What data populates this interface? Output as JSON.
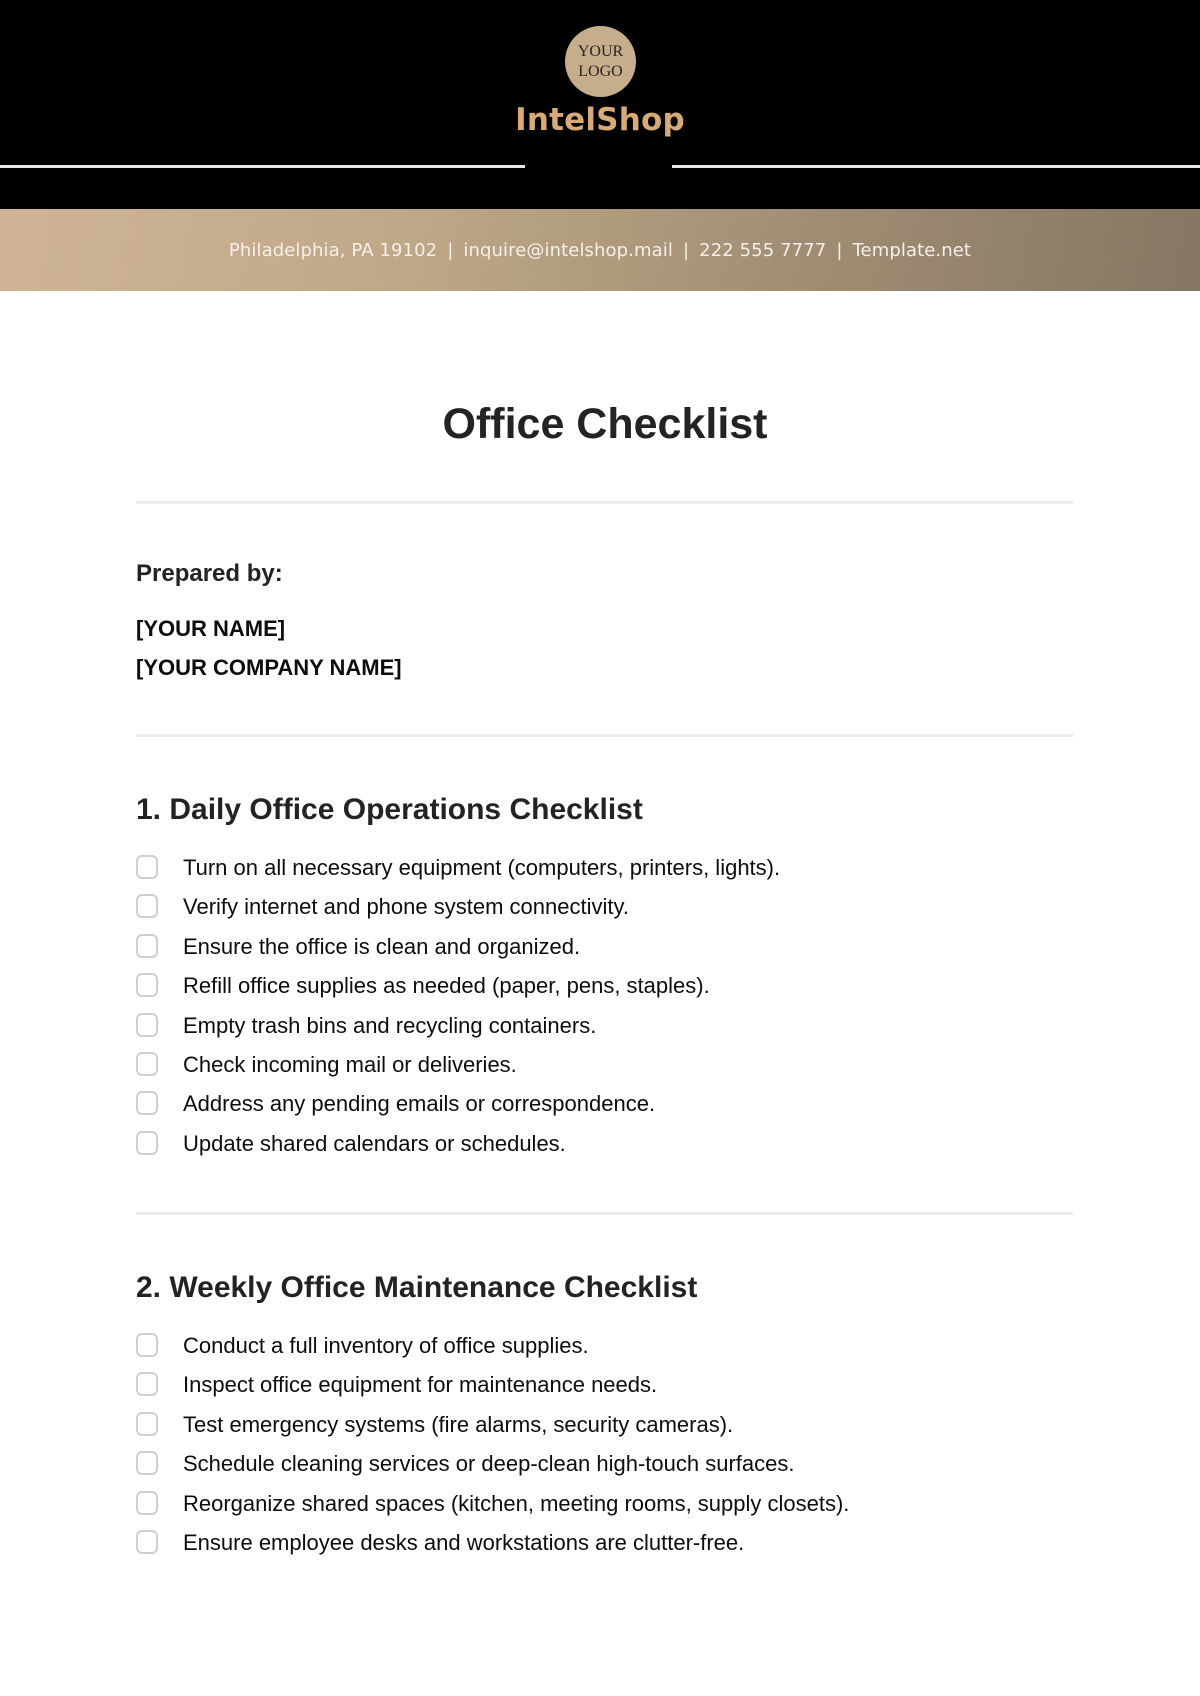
{
  "header": {
    "logo_line1": "YOUR",
    "logo_line2": "LOGO",
    "brand_name": "IntelShop",
    "brand_color": "#d8ab74",
    "background_color": "#000000"
  },
  "contact_bar": {
    "address": "Philadelphia, PA 19102",
    "email": "inquire@intelshop.mail",
    "phone": "222 555 7777",
    "website": "Template.net",
    "separator": "|",
    "gradient_start": "#cfb595",
    "gradient_end": "#857762"
  },
  "document": {
    "title": "Office Checklist",
    "prepared_by_label": "Prepared by:",
    "prepared_name": "[YOUR NAME]",
    "prepared_company": "[YOUR COMPANY NAME]"
  },
  "sections": [
    {
      "title": "1. Daily Office Operations Checklist",
      "items": [
        {
          "text": "Turn on all necessary equipment (computers, printers, lights).",
          "checked": false
        },
        {
          "text": "Verify internet and phone system connectivity.",
          "checked": false
        },
        {
          "text": "Ensure the office is clean and organized.",
          "checked": false
        },
        {
          "text": "Refill office supplies as needed (paper, pens, staples).",
          "checked": false
        },
        {
          "text": "Empty trash bins and recycling containers.",
          "checked": false
        },
        {
          "text": "Check incoming mail or deliveries.",
          "checked": false
        },
        {
          "text": "Address any pending emails or correspondence.",
          "checked": false
        },
        {
          "text": "Update shared calendars or schedules.",
          "checked": false
        }
      ]
    },
    {
      "title": "2. Weekly Office Maintenance Checklist",
      "items": [
        {
          "text": "Conduct a full inventory of office supplies.",
          "checked": false
        },
        {
          "text": "Inspect office equipment for maintenance needs.",
          "checked": false
        },
        {
          "text": "Test emergency systems (fire alarms, security cameras).",
          "checked": false
        },
        {
          "text": "Schedule cleaning services or deep-clean high-touch surfaces.",
          "checked": false
        },
        {
          "text": "Reorganize shared spaces (kitchen, meeting rooms, supply closets).",
          "checked": false
        },
        {
          "text": "Ensure employee desks and workstations are clutter-free.",
          "checked": false
        }
      ]
    }
  ]
}
